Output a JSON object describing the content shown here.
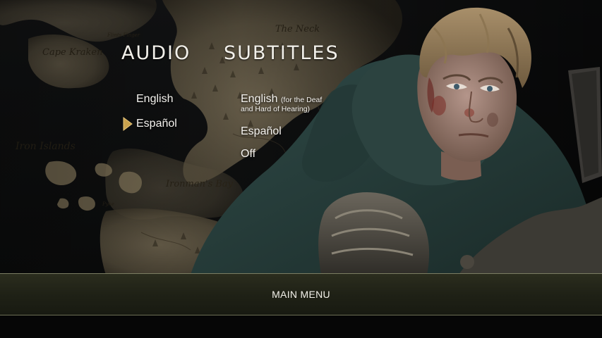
{
  "audio": {
    "heading": "AUDIO",
    "options": [
      {
        "label": "English"
      },
      {
        "label": "Español",
        "selected": true
      }
    ]
  },
  "subtitles": {
    "heading": "SUBTITLES",
    "english": {
      "label": "English",
      "note": "(for the Deaf",
      "note_line2": "and Hard of Hearing)"
    },
    "options": [
      {
        "label": "Español"
      },
      {
        "label": "Off"
      }
    ]
  },
  "footer": {
    "main_menu_label": "MAIN MENU"
  },
  "map": {
    "labels": [
      "Cape Kraken",
      "Iron Islands",
      "Ironman's Bay",
      "The Neck",
      "Flints Finger",
      "Pyke"
    ]
  },
  "icons": {
    "selection_indicator": "play-arrow-icon"
  },
  "colors": {
    "accent_gold": "#c9a24e",
    "text": "#f4f2ee",
    "footer_band": "#22241a"
  }
}
